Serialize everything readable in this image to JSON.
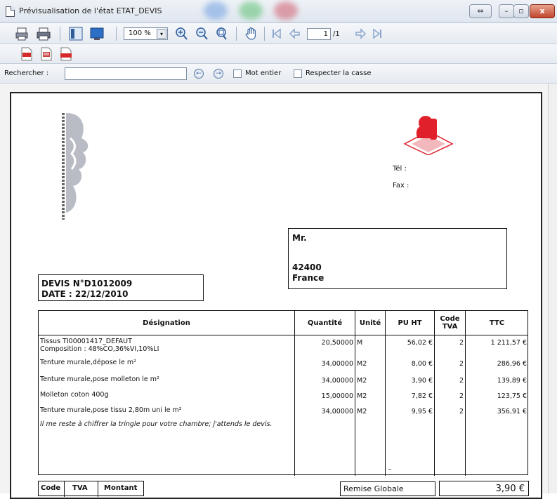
{
  "window": {
    "title": "Prévisualisation de l'état ETAT_DEVIS",
    "restore_glyph": "⇔",
    "minimize_glyph": "–",
    "maximize_glyph": "▫",
    "close_glyph": "x"
  },
  "toolbar": {
    "zoom_value": "100 %",
    "dropdown_glyph": "▾",
    "current_page": "1",
    "page_total": "/1"
  },
  "search": {
    "label": "Rechercher :",
    "value": "",
    "prev_glyph": "←",
    "next_glyph": "→",
    "whole_word_label": "Mot entier",
    "match_case_label": "Respecter la casse"
  },
  "document": {
    "tel_label": "Tél :",
    "fax_label": "Fax :",
    "client": {
      "title": "Mr.",
      "postal_code": "42400",
      "country": "France"
    },
    "devis_number": "DEVIS N°D1012009",
    "devis_date": "DATE : 22/12/2010",
    "table": {
      "headers": {
        "designation": "Désignation",
        "quantity": "Quantité",
        "unit": "Unité",
        "pu_ht": "PU HT",
        "code_tva_1": "Code",
        "code_tva_2": "TVA",
        "ttc": "TTC"
      },
      "rows": [
        {
          "designation": "Tissus TI00001417_DEFAUT",
          "designation_2": "Composition : 48%CO,36%VI,10%LI",
          "quantity": "20,50000",
          "unit": "M",
          "pu_ht": "56,02 €",
          "code_tva": "2",
          "ttc": "1 211,57 €"
        },
        {
          "designation": "Tenture murale,dépose le m²",
          "quantity": "34,00000",
          "unit": "M2",
          "pu_ht": "8,00 €",
          "code_tva": "2",
          "ttc": "286,96 €"
        },
        {
          "designation": "Tenture murale,pose molleton le m²",
          "quantity": "34,00000",
          "unit": "M2",
          "pu_ht": "3,90 €",
          "code_tva": "2",
          "ttc": "139,89 €"
        },
        {
          "designation": "Molleton coton 400g",
          "quantity": "15,00000",
          "unit": "M2",
          "pu_ht": "7,82 €",
          "code_tva": "2",
          "ttc": "123,75 €"
        },
        {
          "designation": "Tenture murale,pose tissu 2,80m uni le m²",
          "quantity": "34,00000",
          "unit": "M2",
          "pu_ht": "9,95 €",
          "code_tva": "2",
          "ttc": "356,91 €"
        }
      ],
      "note": "Il me reste à chiffrer la tringle pour votre chambre; j'attends le devis."
    },
    "footer": {
      "code_label": "Code",
      "tva_label": "TVA",
      "montant_label": "Montant",
      "remise_label": "Remise Globale",
      "remise_value": "3,90 €"
    }
  },
  "colors": {
    "logo_red": "#e0202a",
    "title_glow_blue": "#6f9fe0",
    "title_glow_green": "#5cc070",
    "title_glow_red": "#d05a6a"
  }
}
